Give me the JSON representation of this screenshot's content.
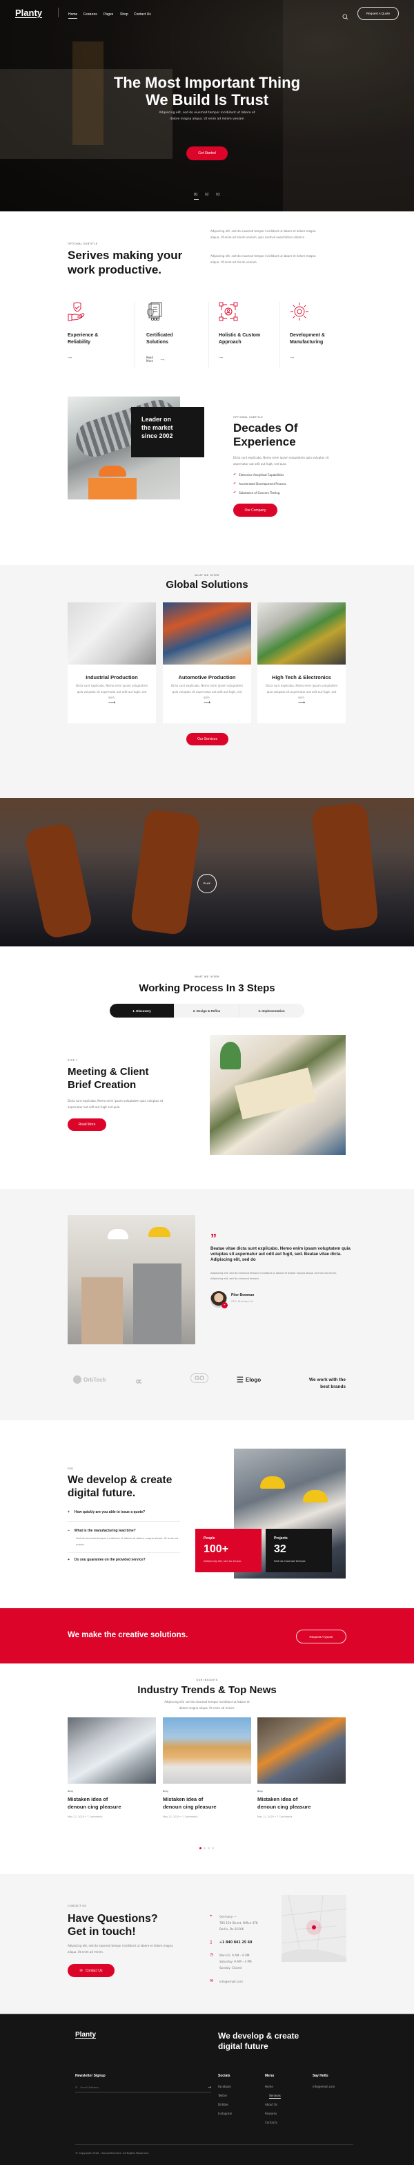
{
  "colors": {
    "accent": "#dc0529",
    "dark": "#151515",
    "light_bg": "#f5f5f5"
  },
  "header": {
    "logo": "Planty",
    "nav": [
      "Home",
      "Features",
      "Pages",
      "Shop",
      "Contact Us"
    ],
    "active_nav": "Home",
    "search_icon": "search-icon",
    "quote_button": "Request A Quote"
  },
  "hero": {
    "title_line1": "The Most Important Thing",
    "title_line2": "We Build Is Trust",
    "subtitle_line1": "Adipiscing elit, sed do eiusmod tempor incididunt ut labore et",
    "subtitle_line2": "dolore magna aliqua. Ut enim ad minim veniam",
    "cta": "Get Started",
    "slides": [
      "01",
      "02",
      "03"
    ],
    "active_slide": "01"
  },
  "services": {
    "eyebrow": "Optional Subtitle",
    "title_line1": "Serives making your",
    "title_line2": "work productive.",
    "para1": "Adipiscing elit, sed do eiusmod tempor incididunt ut labore et dolore magna aliqua. Ut enim ad minim veniam, quis nostrud exercitation ullamco .",
    "para2": "Adipiscing elit, sed do eiusmod tempor incididunt ut labore et dolore magna aliqua. Ut enim ad minim veniam.",
    "features": [
      {
        "title_line1": "Experience &",
        "title_line2": "Reliability",
        "icon": "hand-shield-icon",
        "link": ""
      },
      {
        "title_line1": "Certificated",
        "title_line2": "Solutions",
        "icon": "certificate-icon",
        "link": "Read More"
      },
      {
        "title_line1": "Holistic & Custom",
        "title_line2": "Approach",
        "icon": "network-icon",
        "link": ""
      },
      {
        "title_line1": "Development &",
        "title_line2": "Manufacturing",
        "icon": "gear-icon",
        "link": ""
      }
    ]
  },
  "about": {
    "badge_line1": "Leader on",
    "badge_line2": "the market",
    "badge_line3": "since 2002",
    "eyebrow": "Optional Subtitle",
    "title_line1": "Decades Of",
    "title_line2": "Experience",
    "desc": "Dicta sunt explicabo. Nemo enim ipsam voluptatem quia voluptas sit aspernatur aut odit aut fugit, sed quia.",
    "checks": [
      "Extensive Analytical Capabilities",
      "Accelerated Development Process",
      "Substance of Concern Testing"
    ],
    "cta": "Our Company"
  },
  "solutions": {
    "eyebrow": "What We Offer",
    "title": "Global Solutions",
    "cards": [
      {
        "title": "Industrial Production",
        "desc": "Dicta sunt explicabo. Nemo enim ipsam voluptatem quia voluptas sit aspernatur aut odit aut fugit, sed quia."
      },
      {
        "title": "Automotive Production",
        "desc": "Dicta sunt explicabo. Nemo enim ipsam voluptatem quia voluptas sit aspernatur aut odit aut fugit, sed quia."
      },
      {
        "title": "High Tech & Electronics",
        "desc": "Dicta sunt explicabo. Nemo enim ipsam voluptatem quia voluptas sit aspernatur aut odit aut fugit, sed quia."
      }
    ],
    "cta": "Our Services"
  },
  "video": {
    "play_label": "PLAY"
  },
  "process": {
    "eyebrow": "What We Offer",
    "title": "Working Process In 3 Steps",
    "tabs": [
      "1. Discovery",
      "2. Design & Refine",
      "3. Implementation"
    ],
    "active_tab": "1. Discovery",
    "step_label": "Step 1",
    "step_title_line1": "Meeting & Client",
    "step_title_line2": "Brief Creation",
    "step_desc": "Dicta sunt explicabo. Nemo enim ipsam voluptatem quia voluptas sit aspernatur aut odit aut fugit sed quia.",
    "cta": "Read More"
  },
  "testimonial": {
    "quote_mark": "”",
    "quote": "Beatae vitae dicta sunt explicabo. Nemo enim ipsam voluptatem quia voluptas sit aspernatur aut odit aut fugit, sed. Beatae vitae dicta. Adipiscing elit, sed do",
    "body": "Adipiscing elit, sed do eiusmod tempor incididunt ut labore et dolore magna aliqua ut enim ad minim. Adipiscing elit, sed do eiusmod tempor.",
    "author": "Piter Bowman",
    "role": "CEO, Business Co."
  },
  "brands": {
    "logos": [
      "OrbTech",
      "∝",
      "GO",
      "Elogo"
    ],
    "tagline_line1": "We work with the",
    "tagline_line2": "best brands"
  },
  "faq": {
    "eyebrow": "FAQ",
    "title_line1": "We develop & create",
    "title_line2": "digital future.",
    "items": [
      {
        "q": "How quickly are you able to issue a quote?",
        "open": false,
        "toggle": "+"
      },
      {
        "q": "What is the manufacturing lead time?",
        "open": true,
        "toggle": "–",
        "a": "Sed do eiusmod tempor incididunt ut labore et dolore magna aliqua. Ut enim ad minim."
      },
      {
        "q": "Do you guarantee on the provided service?",
        "open": false,
        "toggle": "+"
      }
    ],
    "stats": [
      {
        "label": "People",
        "value": "100+",
        "desc": "Adipiscing elit, sed do eiusm."
      },
      {
        "label": "Projects",
        "value": "32",
        "desc": "Sed do eiusmod tempor."
      }
    ]
  },
  "cta_band": {
    "text": "We make the creative solutions.",
    "button": "Request A Quote"
  },
  "news": {
    "eyebrow": "Our Insights",
    "title": "Industry Trends & Top News",
    "subtitle_line1": "Adipiscing elit, sed do eiusmod tempor incididunt ut labore et",
    "subtitle_line2": "dolore magna aliqua. Ut enim ad minim.",
    "posts": [
      {
        "category": "Blog",
        "title_line1": "Mistaken idea of",
        "title_line2": "denoun cing pleasure",
        "date": "May 22, 2020",
        "comments": "7 Comments"
      },
      {
        "category": "Blog",
        "title_line1": "Mistaken idea of",
        "title_line2": "denoun cing pleasure",
        "date": "May 22, 2020",
        "comments": "7 Comments"
      },
      {
        "category": "Blog",
        "title_line1": "Mistaken idea of",
        "title_line2": "denoun cing pleasure",
        "date": "May 22, 2020",
        "comments": "7 Comments"
      }
    ],
    "pagination_count": 4,
    "active_page": 1
  },
  "contact": {
    "eyebrow": "Contact Us",
    "title_line1": "Have Questions?",
    "title_line2": "Get in touch!",
    "desc": "Adipiscing elit, sed do eiusmod tempor incididunt ut labore et dolore magna aliqua. Ut enim ad minim.",
    "cta": "Contact Us",
    "address_line1": "Germany —",
    "address_line2": "785 15h Street, Office 478",
    "address_line3": "Berlin, De 81566",
    "phone": "+1 840 841 25 69",
    "hours_line1": "Mon-Fri: 9 AM – 6 PM",
    "hours_line2": "Saturday: 9 AM – 4 PM",
    "hours_line3": "Sunday: Closed",
    "email": "info@email.com"
  },
  "footer": {
    "logo": "Planty",
    "tagline_line1": "We develop & create",
    "tagline_line2": "digital future",
    "newsletter_heading": "Newsletter Signup",
    "email_placeholder": "Email Address",
    "socials_heading": "Socials",
    "socials": [
      "Facebook",
      "Twitter",
      "Dribble",
      "Instagram"
    ],
    "menu_heading": "Menu",
    "menu": [
      "Home",
      "Services",
      "About Us",
      "Features",
      "Contacts"
    ],
    "active_menu": "Services",
    "hello_heading": "Say Hello",
    "hello_email": "info@email.com",
    "copyright": "© Copyright 2020 - AncoraThemes. All Rights Reserved."
  }
}
